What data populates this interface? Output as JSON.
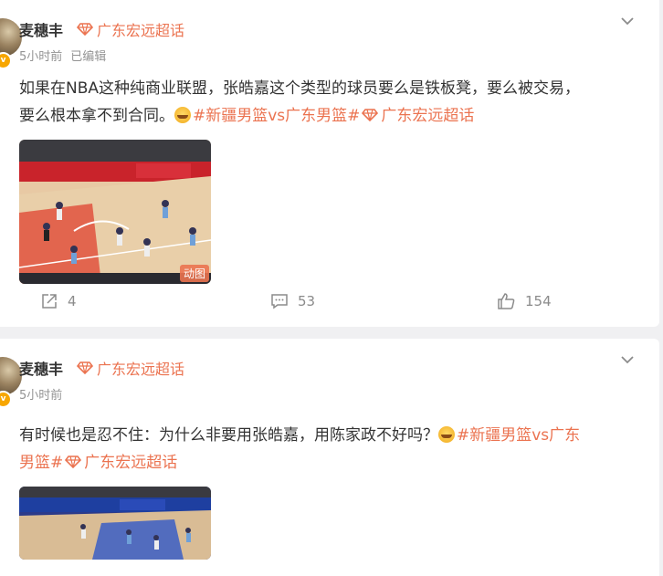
{
  "colors": {
    "accent": "#eb7350",
    "name": "#333333",
    "meta": "#939393"
  },
  "posts": [
    {
      "author": "麦穗丰",
      "supertopic": "广东宏远超话",
      "time": "5小时前",
      "edited": "已编辑",
      "text_line1": "如果在NBA这种纯商业联盟，张皓嘉这个类型的球员要么是铁板凳，要么被交易，",
      "text_line2_plain": "要么根本拿不到合同。",
      "topic_tag": "#新疆男篮vs广东男篮#",
      "topic_super": "广东宏远超话",
      "media_badge": "动图",
      "repost_count": "4",
      "comment_count": "53",
      "like_count": "154"
    },
    {
      "author": "麦穗丰",
      "supertopic": "广东宏远超话",
      "time": "5小时前",
      "text_line1_plain": "有时候也是忍不住：为什么非要用张皓嘉，用陈家政不好吗？",
      "topic_tag_part1": "#新疆男篮vs广东",
      "topic_tag_part2": "男篮#",
      "topic_super": "广东宏远超话"
    }
  ]
}
